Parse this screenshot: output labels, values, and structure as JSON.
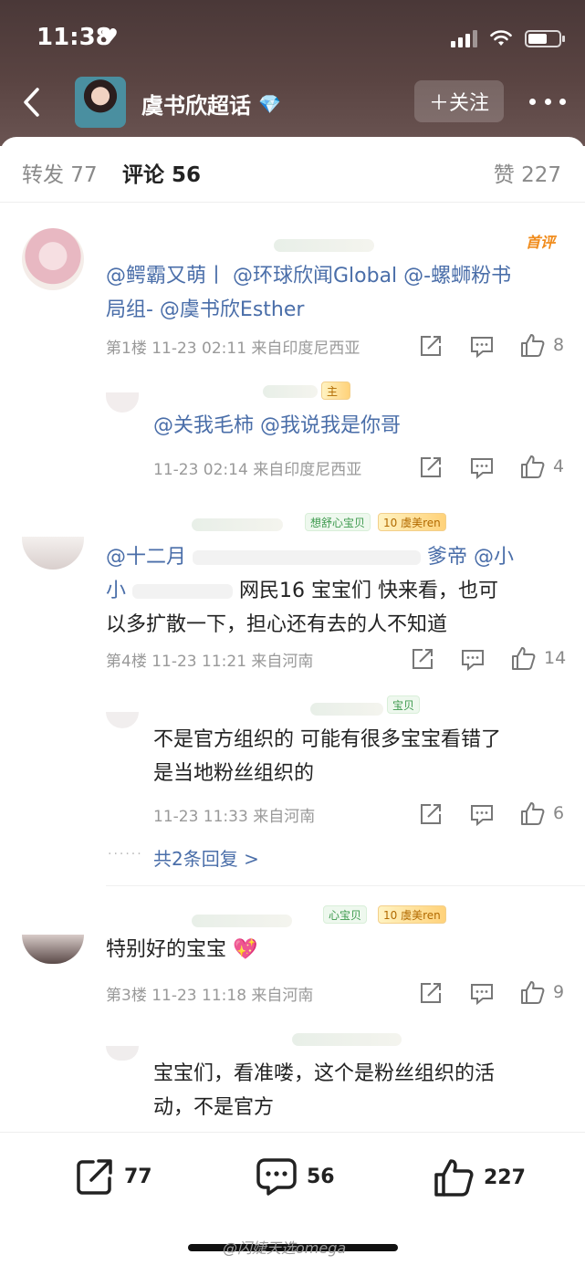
{
  "status_bar": {
    "time": "11:38"
  },
  "header": {
    "title": "虞书欣超话",
    "follow_label": "＋关注"
  },
  "tabs": {
    "repost": "转发 77",
    "comments": "评论 56",
    "likes": "赞 227"
  },
  "comments": [
    {
      "badge": "首评",
      "text_mentions": "@鳄霸又萌丨 @环球欣闻Global @-螺蛳粉书局组- @虞书欣Esther",
      "line1": "@鳄霸又萌丨 @环球欣闻Global @-螺蛳粉书",
      "line2": "局组- @虞书欣Esther",
      "meta": "第1楼 11-23 02:11 来自印度尼西亚",
      "likes": "8",
      "reply": {
        "text": "@关我毛柿 @我说我是你哥",
        "meta": "11-23 02:14 来自印度尼西亚",
        "likes": "4"
      }
    },
    {
      "tags": [
        "想舒心宝贝",
        "10 虞美ren"
      ],
      "line1_start": "@十二月",
      "line1_end": "爹帝 @小",
      "line2_start": "小",
      "line2_end": "网民16  宝宝们 快来看，也可",
      "line3": "以多扩散一下，担心还有去的人不知道",
      "meta": "第4楼 11-23 11:21 来自河南",
      "likes": "14",
      "reply": {
        "tag": "宝贝",
        "line1": "不是官方组织的   可能有很多宝宝看错了",
        "line2": "是当地粉丝组织的",
        "meta": "11-23 11:33 来自河南",
        "likes": "6"
      },
      "more_replies": "共2条回复 >"
    },
    {
      "tags": [
        "心宝贝",
        "10 虞美ren"
      ],
      "text": "特别好的宝宝",
      "meta": "第3楼 11-23 11:18 来自河南",
      "likes": "9",
      "reply": {
        "line1": "宝宝们，看准喽，这个是粉丝组织的活",
        "line2": "动，不是官方"
      }
    }
  ],
  "bottom_bar": {
    "reposts": "77",
    "comments": "56",
    "likes": "227"
  },
  "watermark": "@闪婕天选omega",
  "colors": {
    "mention": "#4a6ea9",
    "first_badge": "#f08b1b",
    "header_bg": "#4a3838"
  }
}
